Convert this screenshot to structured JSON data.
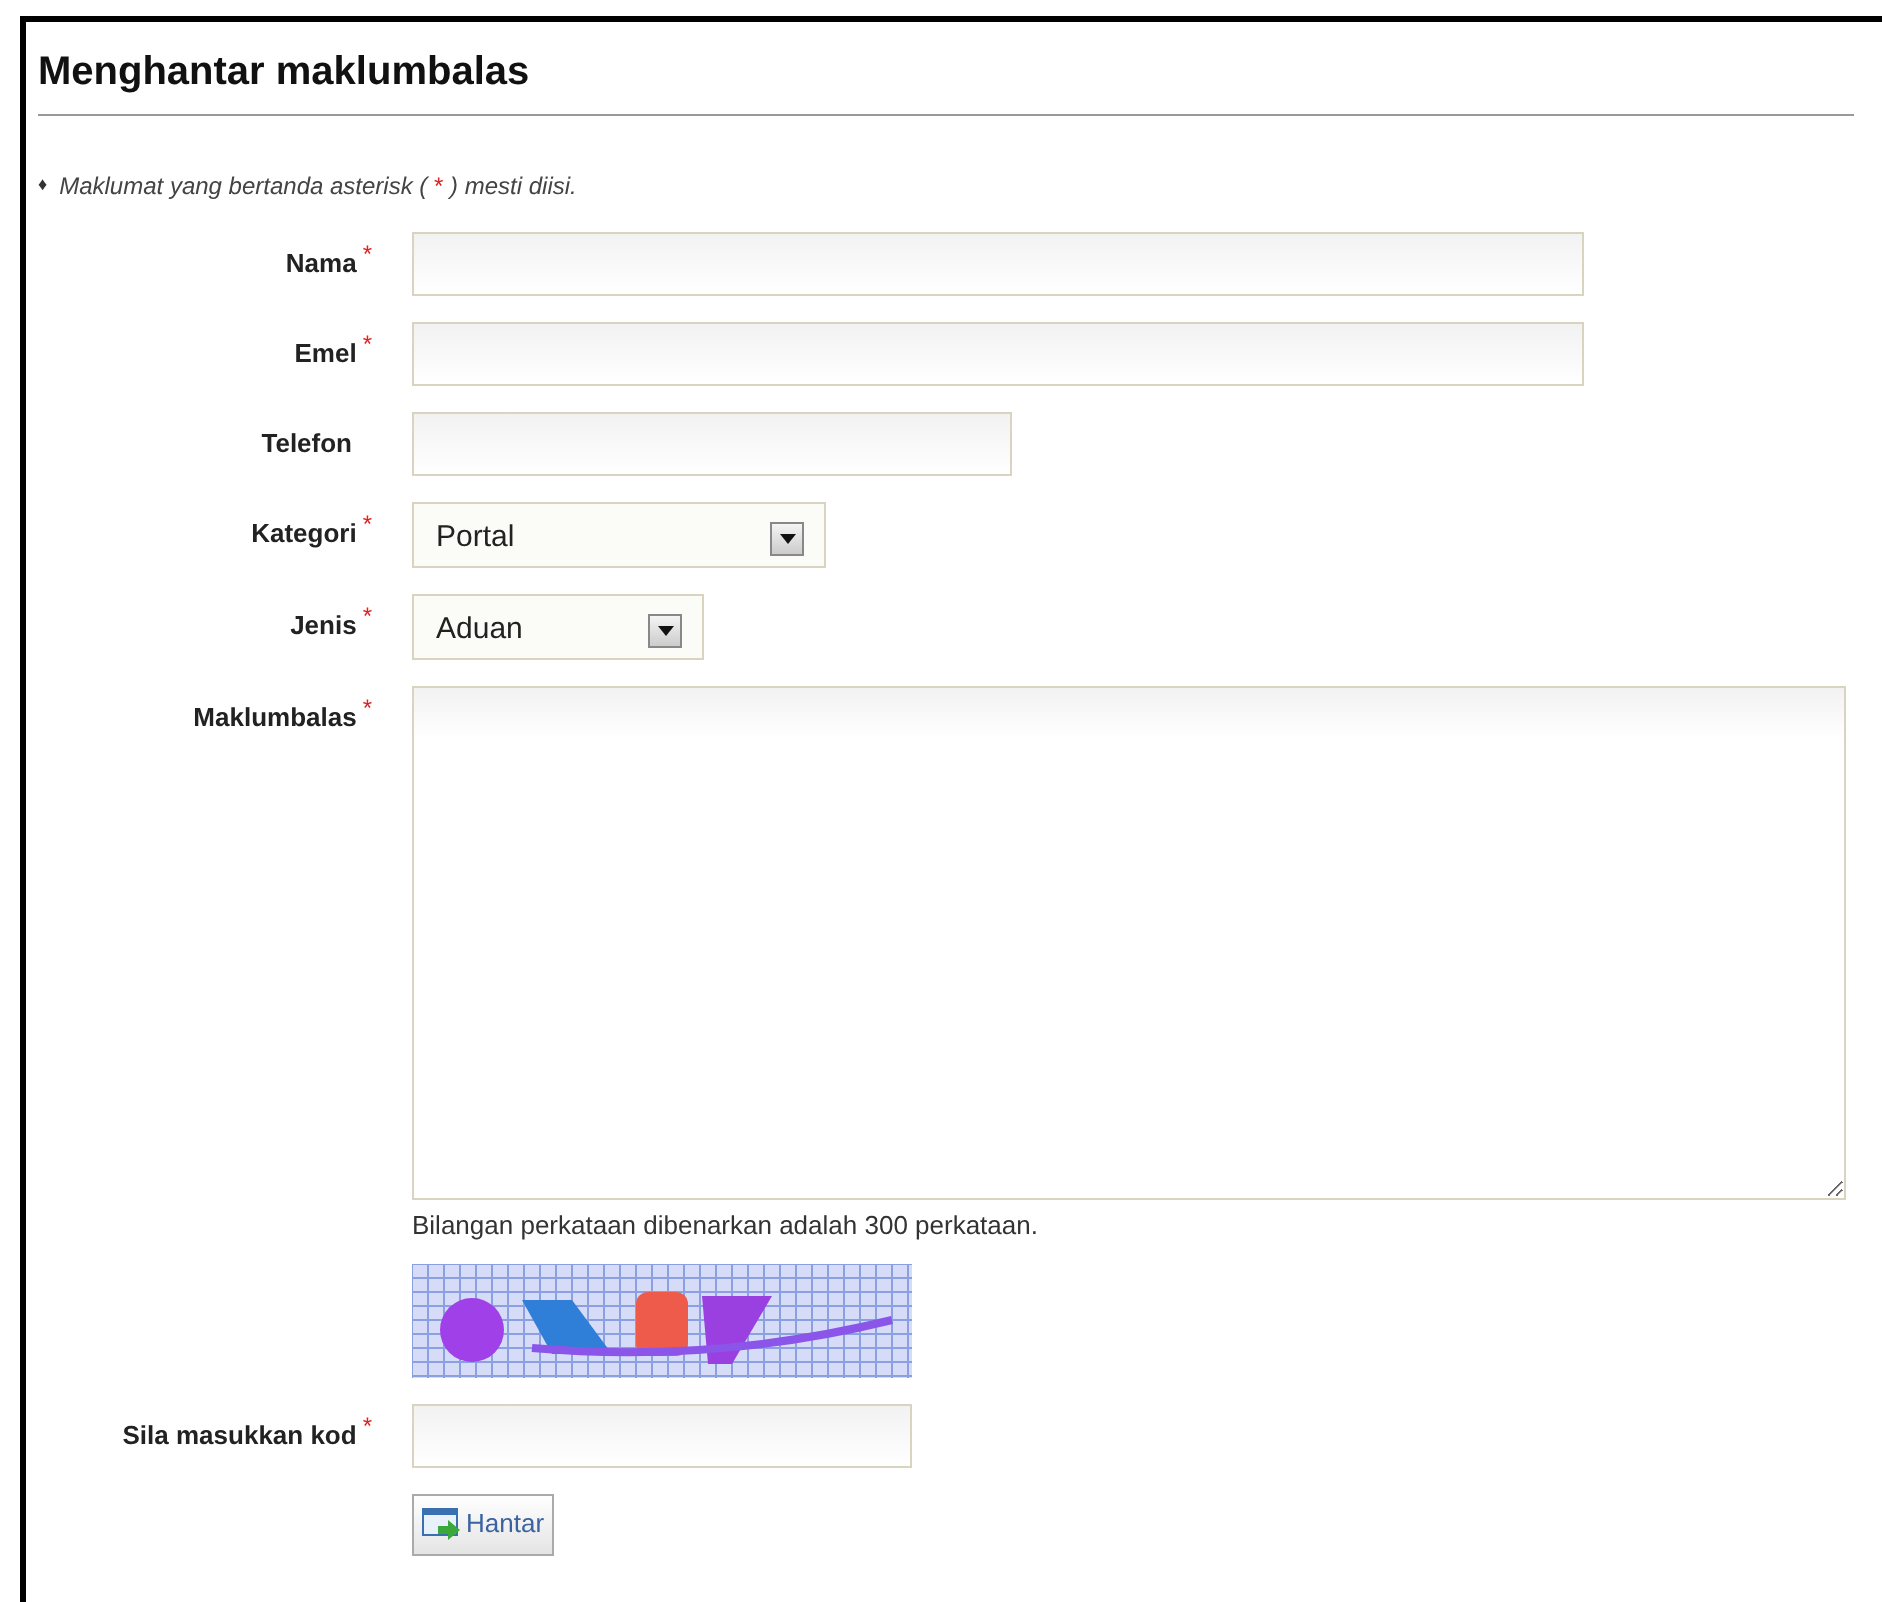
{
  "title": "Menghantar maklumbalas",
  "note": {
    "bullet": "♦",
    "text": "Maklumat yang bertanda asterisk (",
    "mark": "*",
    "after": ") mesti diisi."
  },
  "fields": [
    {
      "kind": "text",
      "label": "Nama",
      "required": true
    },
    {
      "kind": "text",
      "label": "Emel",
      "required": true
    },
    {
      "kind": "text",
      "label": "Telefon",
      "required": false
    },
    {
      "kind": "select",
      "label": "Kategori",
      "required": true,
      "value": "Portal"
    },
    {
      "kind": "select",
      "label": "Jenis",
      "required": true,
      "value": "Aduan"
    },
    {
      "kind": "textarea",
      "label": "Maklumbalas",
      "required": true,
      "hint": "Bilangan perkataan dibenarkan adalah 300 perkataan."
    },
    {
      "kind": "captcha"
    },
    {
      "kind": "text",
      "label": "Sila masukkan kod",
      "required": true
    }
  ],
  "submit": {
    "label": "Hantar"
  }
}
